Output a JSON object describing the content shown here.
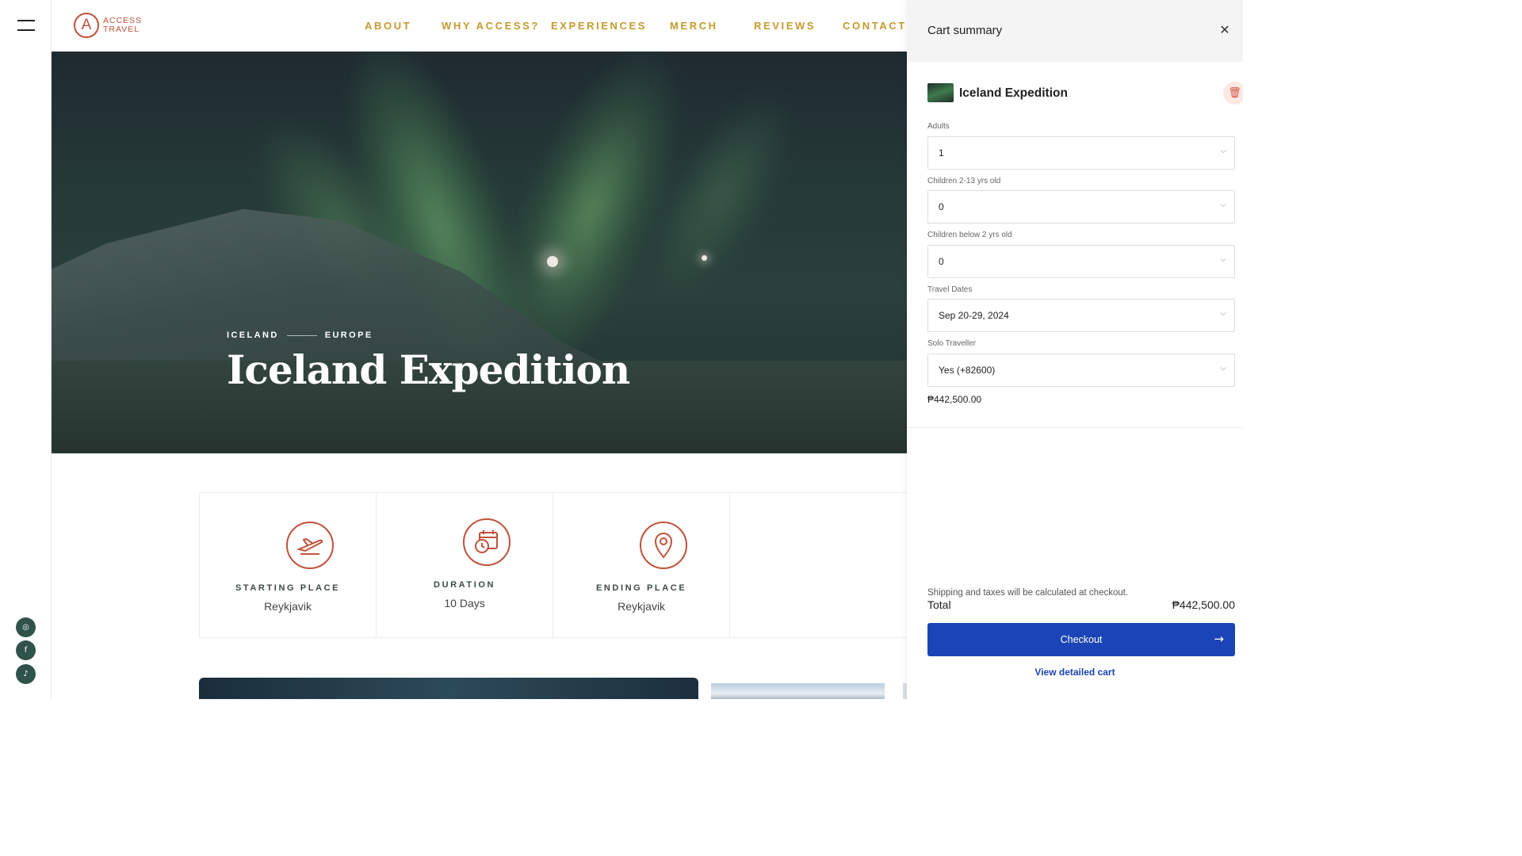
{
  "brand": {
    "line1": "ACCESS",
    "line2": "TRAVEL",
    "mark": "A"
  },
  "nav": [
    {
      "label": "ABOUT"
    },
    {
      "label": "WHY ACCESS?"
    },
    {
      "label": "EXPERIENCES"
    },
    {
      "label": "MERCH"
    },
    {
      "label": "REVIEWS"
    },
    {
      "label": "CONTACT"
    }
  ],
  "hero": {
    "country": "ICELAND",
    "region": "EUROPE",
    "title": "Iceland Expedition"
  },
  "info_cards": [
    {
      "icon": "airplane-icon",
      "label": "STARTING PLACE",
      "value": "Reykjavik"
    },
    {
      "icon": "calendar-clock-icon",
      "label": "DURATION",
      "value": "10 Days"
    },
    {
      "icon": "map-pin-icon",
      "label": "ENDING PLACE",
      "value": "Reykjavik"
    }
  ],
  "social": [
    {
      "icon": "instagram-icon",
      "glyph": "◎"
    },
    {
      "icon": "facebook-icon",
      "glyph": "f"
    },
    {
      "icon": "tiktok-icon",
      "glyph": "♪"
    }
  ],
  "cart": {
    "title": "Cart summary",
    "close_glyph": "✕",
    "item": {
      "name": "Iceland Expedition",
      "trash_glyph": "🗑",
      "fields": [
        {
          "label": "Adults",
          "value": "1"
        },
        {
          "label": "Children 2-13 yrs old",
          "value": "0"
        },
        {
          "label": "Children below 2 yrs old",
          "value": "0"
        },
        {
          "label": "Travel Dates",
          "value": "Sep 20-29, 2024"
        },
        {
          "label": "Solo Traveller",
          "value": "Yes (+82600)"
        }
      ],
      "price": "₱442,500.00"
    },
    "shipping_note": "Shipping and taxes will be calculated at checkout.",
    "total_label": "Total",
    "total_value": "₱442,500.00",
    "checkout_label": "Checkout",
    "checkout_arrow": "→",
    "view_cart_label": "View detailed cart"
  },
  "colors": {
    "brand": "#c0523a",
    "nav": "#c59a2e",
    "checkout": "#1b44b6",
    "social": "#2f5249"
  }
}
